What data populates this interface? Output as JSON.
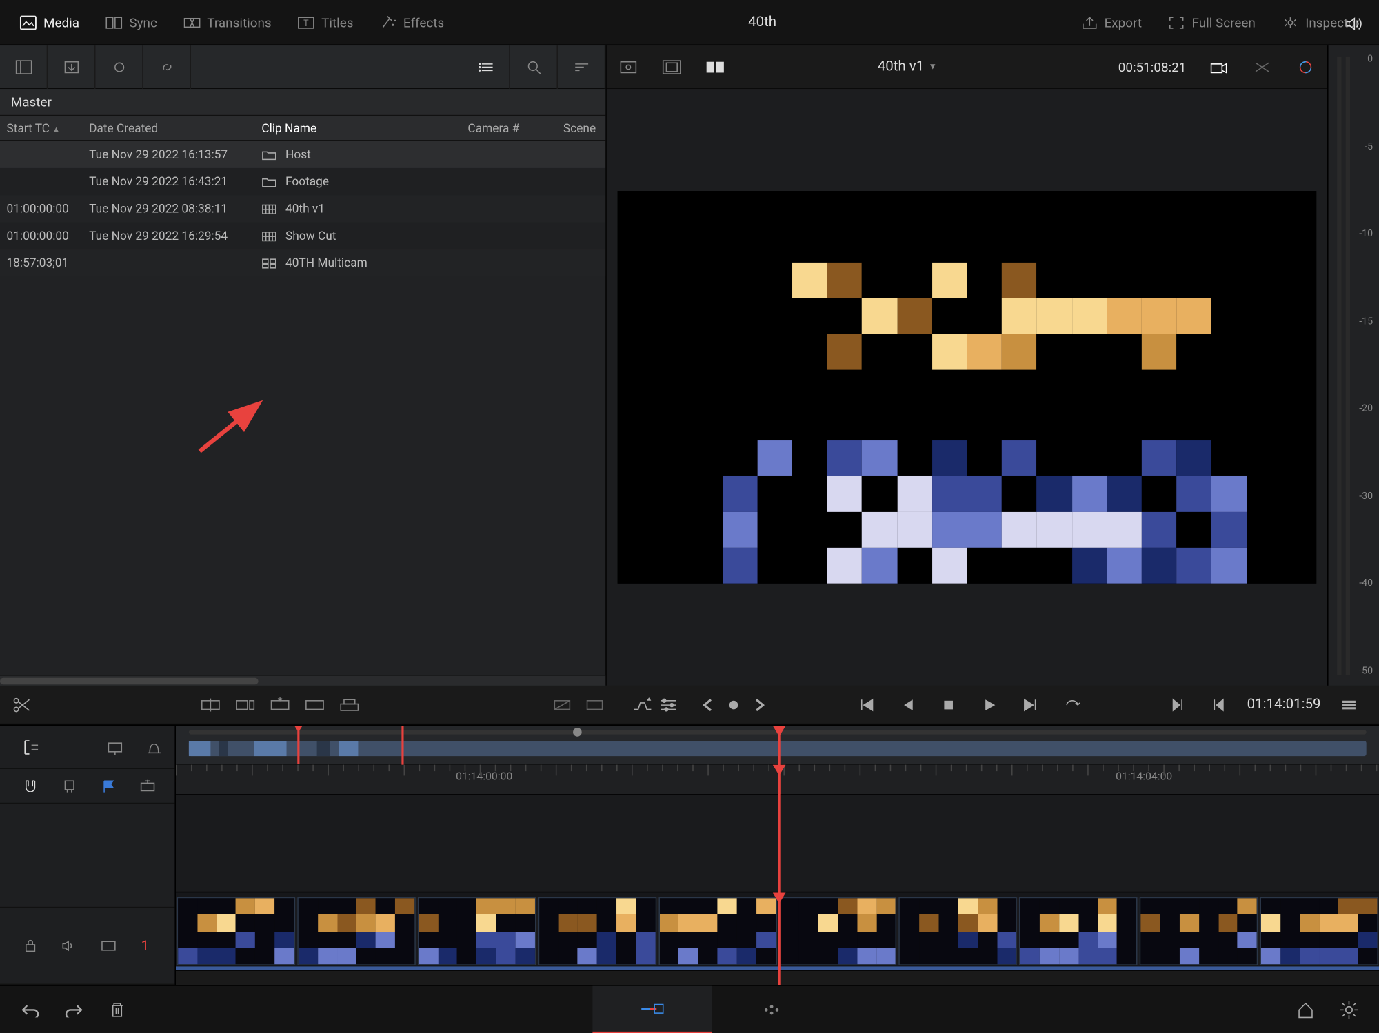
{
  "project": {
    "title": "40th"
  },
  "topbar": {
    "tabs": [
      {
        "label": "Media",
        "active": true
      },
      {
        "label": "Sync"
      },
      {
        "label": "Transitions"
      },
      {
        "label": "Titles"
      },
      {
        "label": "Effects"
      }
    ],
    "right": [
      {
        "label": "Export"
      },
      {
        "label": "Full Screen"
      },
      {
        "label": "Inspector"
      }
    ]
  },
  "mediaPool": {
    "masterLabel": "Master",
    "columns": {
      "startTC": "Start TC",
      "dateCreated": "Date Created",
      "clipName": "Clip Name",
      "camera": "Camera #",
      "scene": "Scene"
    },
    "rows": [
      {
        "startTC": "",
        "date": "Tue Nov 29 2022 16:13:57",
        "type": "bin",
        "name": "Host"
      },
      {
        "startTC": "",
        "date": "Tue Nov 29 2022 16:43:21",
        "type": "bin",
        "name": "Footage"
      },
      {
        "startTC": "01:00:00:00",
        "date": "Tue Nov 29 2022 08:38:11",
        "type": "timeline",
        "name": "40th v1"
      },
      {
        "startTC": "01:00:00:00",
        "date": "Tue Nov 29 2022 16:29:54",
        "type": "timeline",
        "name": "Show Cut"
      },
      {
        "startTC": "18:57:03;01",
        "date": "",
        "type": "multicam",
        "name": "40TH  Multicam"
      }
    ]
  },
  "viewer": {
    "clipName": "40th v1",
    "sourceTC": "00:51:08:21",
    "recordTC": "01:14:01:59",
    "meterMarks": [
      "0",
      "-5",
      "-10",
      "-15",
      "-20",
      "-30",
      "-40",
      "-50"
    ]
  },
  "timeline": {
    "rulerTC": [
      "01:14:00:00",
      "01:14:04:00"
    ],
    "trackNumber": "1"
  },
  "pages": {
    "active": "cut"
  }
}
